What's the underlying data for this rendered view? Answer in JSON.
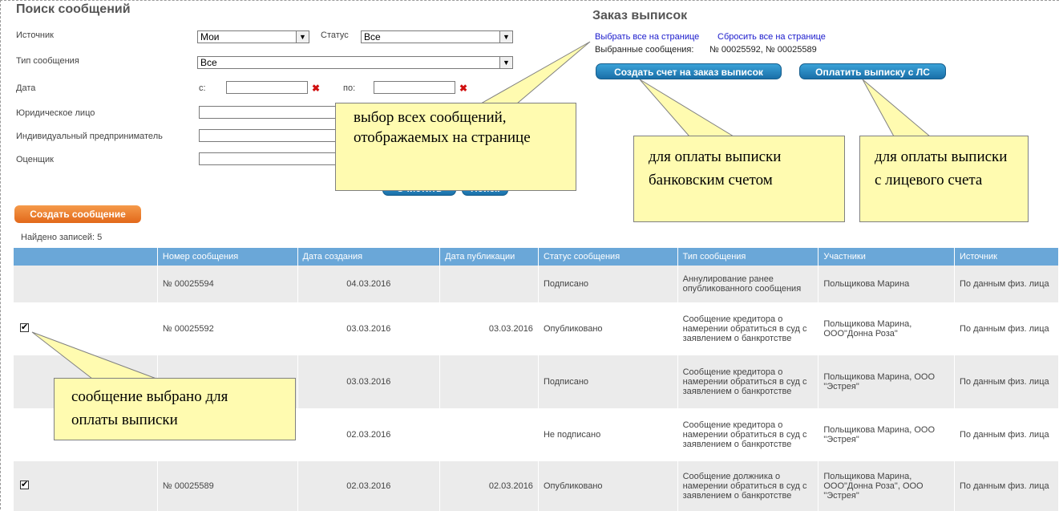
{
  "search": {
    "title": "Поиск сообщений",
    "source_label": "Источник",
    "source_value": "Мои",
    "status_label": "Статус",
    "status_value": "Все",
    "type_label": "Тип сообщения",
    "type_value": "Все",
    "date_label": "Дата",
    "date_from_label": "с:",
    "date_to_label": "по:",
    "legal_entity_label": "Юридическое лицо",
    "entrepreneur_label": "Индивидуальный предприниматель",
    "appraiser_label": "Оценщик",
    "clear_label": "Очистить",
    "search_label": "Поиск"
  },
  "order": {
    "title": "Заказ выписок",
    "select_all": "Выбрать все на странице",
    "reset_all": "Сбросить все на странице",
    "selected_label": "Выбранные сообщения:",
    "selected_value": "№ 00025592, № 00025589",
    "create_invoice": "Создать счет на заказ выписок",
    "pay_from_account": "Оплатить выписку с ЛС"
  },
  "create_message": "Создать сообщение",
  "found": "Найдено записей: 5",
  "table": {
    "headers": [
      "",
      "Номер сообщения",
      "Дата создания",
      "Дата публикации",
      "Статус сообщения",
      "Тип сообщения",
      "Участники",
      "Источник"
    ],
    "rows": [
      {
        "checked": false,
        "number": "№ 00025594",
        "created": "04.03.2016",
        "published": "",
        "status": "Подписано",
        "type": "Аннулирование ранее опубликованного сообщения",
        "participants": "Польщикова Марина",
        "source": "По данным физ. лица"
      },
      {
        "checked": true,
        "number": "№ 00025592",
        "created": "03.03.2016",
        "published": "03.03.2016",
        "status": "Опубликовано",
        "type": "Сообщение кредитора о намерении обратиться в суд с заявлением о банкротстве",
        "participants": "Польщикова Марина, ООО\"Донна Роза\"",
        "source": "По данным физ. лица"
      },
      {
        "checked": false,
        "number": "",
        "created": "03.03.2016",
        "published": "",
        "status": "Подписано",
        "type": "Сообщение кредитора о намерении обратиться в суд с заявлением о банкротстве",
        "participants": "Польщикова Марина, ООО \"Эстрея\"",
        "source": "По данным физ. лица"
      },
      {
        "checked": false,
        "number": "",
        "created": "02.03.2016",
        "published": "",
        "status": "Не подписано",
        "type": "Сообщение кредитора о намерении обратиться в суд с заявлением о банкротстве",
        "participants": "Польщикова Марина, ООО \"Эстрея\"",
        "source": "По данным физ. лица"
      },
      {
        "checked": true,
        "number": "№ 00025589",
        "created": "02.03.2016",
        "published": "02.03.2016",
        "status": "Опубликовано",
        "type": "Сообщение должника о намерении обратиться в суд с заявлением о банкротстве",
        "participants": "Польщикова Марина, ООО\"Донна Роза\", ООО \"Эстрея\"",
        "source": "По данным физ. лица"
      }
    ]
  },
  "callouts": {
    "select_all_note": "выбор всех сообщений, отображаемых на странице",
    "bank_note": "для оплаты выписки банковским счетом",
    "account_note": "для оплаты выписки с лицевого счета",
    "selected_note": "сообщение выбрано для оплаты выписки"
  },
  "colors": {
    "header_bg": "#6aa7d8",
    "blue_button": "#1a6fa8",
    "orange_button": "#e2681a",
    "callout_bg": "#fffbb0",
    "clear_icon": "#d01010",
    "link": "#1a1acc"
  }
}
